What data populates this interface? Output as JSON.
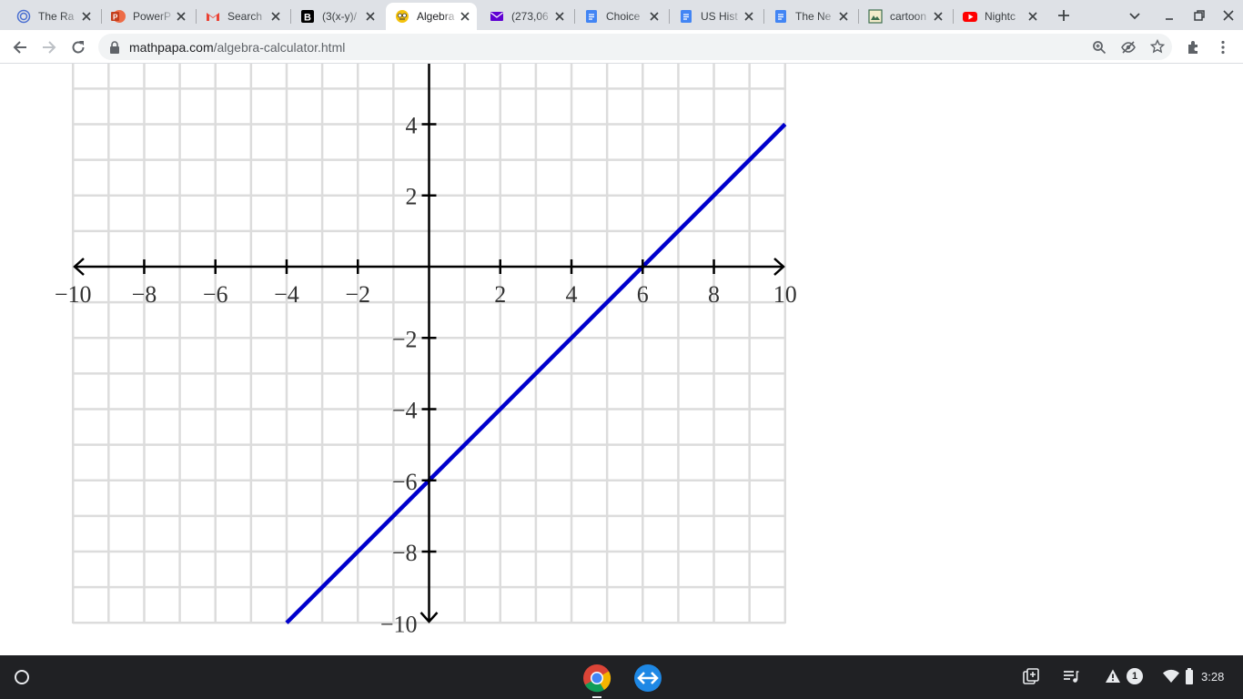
{
  "browser": {
    "tabs": [
      {
        "title": "The Ra",
        "icon": "circle-logo-icon",
        "active": false
      },
      {
        "title": "PowerP",
        "icon": "powerpoint-icon",
        "active": false
      },
      {
        "title": "Search",
        "icon": "gmail-icon",
        "active": false
      },
      {
        "title": "(3(x-y)/",
        "icon": "brainly-icon",
        "active": false
      },
      {
        "title": "Algebra",
        "icon": "mathpapa-icon",
        "active": true
      },
      {
        "title": "(273,06",
        "icon": "yahoo-mail-icon",
        "active": false
      },
      {
        "title": "Choice",
        "icon": "google-docs-icon",
        "active": false
      },
      {
        "title": "US Hist",
        "icon": "google-docs-icon",
        "active": false
      },
      {
        "title": "The Ne",
        "icon": "google-docs-icon",
        "active": false
      },
      {
        "title": "cartoon",
        "icon": "cartoon-site-icon",
        "active": false
      },
      {
        "title": "Nightc",
        "icon": "youtube-icon",
        "active": false
      }
    ],
    "url": {
      "domain": "mathpapa.com",
      "path": "/algebra-calculator.html"
    }
  },
  "chart_data": {
    "type": "line",
    "xlim": [
      -10,
      10
    ],
    "ylim": [
      -10,
      10
    ],
    "grid": true,
    "x_ticks": [
      -10,
      -8,
      -6,
      -4,
      -2,
      2,
      4,
      6,
      8,
      10
    ],
    "y_ticks": [
      4,
      2,
      -2,
      -4,
      -6,
      -8,
      -10
    ],
    "x_tick_labels": [
      "−10",
      "−8",
      "−6",
      "−4",
      "−2",
      "2",
      "4",
      "6",
      "8",
      "10"
    ],
    "y_tick_labels": [
      "4",
      "2",
      "−2",
      "−4",
      "−6",
      "−8",
      "−10"
    ],
    "series": [
      {
        "color": "#0000cc",
        "x": [
          -4,
          10
        ],
        "y": [
          -10,
          4
        ]
      }
    ]
  },
  "shelf": {
    "clock": "3:28",
    "notification_count": "1"
  }
}
